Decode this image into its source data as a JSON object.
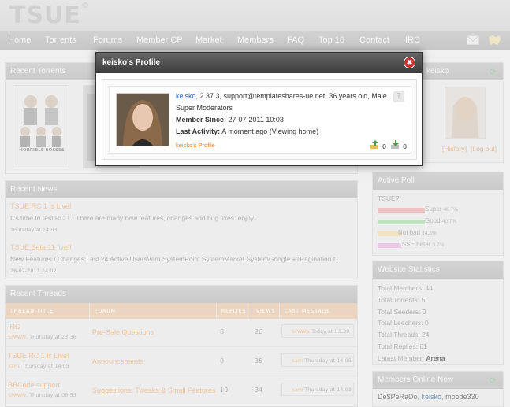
{
  "site": {
    "logo": "TSUE",
    "logo_mark": "©"
  },
  "nav": [
    "Home",
    "Torrents",
    "Forums",
    "Member CP",
    "Market",
    "Members",
    "FAQ",
    "Top 10",
    "Contact",
    "IRC"
  ],
  "recent_torrents": {
    "title": "Recent Torrents",
    "poster_caption": "HORRIBLE BOSSES"
  },
  "user_panel": {
    "title": "keisko",
    "links": [
      "[History]",
      "[Log out]"
    ]
  },
  "recent_news": {
    "title": "Recent News",
    "items": [
      {
        "title": "TSUE RC 1 is Live!",
        "text": "It's time to test RC 1.. There are many new features, changes and bug fixes. enjoy...",
        "date": "Thursday at 14:03"
      },
      {
        "title": "TSUE Beta 11 live!!",
        "text": "New Features / Changes:Last 24 Active Users\\/am SystemPoint SystemMarket SystemGoogle +1Pagination t...",
        "date": "26-07-2011 14:02"
      }
    ]
  },
  "recent_threads": {
    "title": "Recent Threads",
    "columns": [
      "THREAD TITLE",
      "FORUM",
      "REPLIES",
      "VIEWS",
      "LAST MESSAGE"
    ],
    "rows": [
      {
        "title": "IRC",
        "user": "SPAWN",
        "date": ", Thursday at 23:36",
        "forum": "Pre-Sale Questions",
        "replies": "8",
        "views": "26",
        "last_user": "SPAWN",
        "last_date": " Today at 03:39"
      },
      {
        "title": "TSUE RC 1 is Live!",
        "user": "xam",
        "date": ", Thursday at 14:05",
        "forum": "Announcements",
        "replies": "0",
        "views": "35",
        "last_user": "xam",
        "last_date": " Thursday at 14:05"
      },
      {
        "title": "BBCode support",
        "user": "SPAWN",
        "date": ", Thursday at 06:55",
        "forum": "Suggestions: Tweaks & Small Features",
        "replies": "10",
        "views": "34",
        "last_user": "xam",
        "last_date": " Thursday at 14:03"
      }
    ]
  },
  "poll": {
    "title": "Active Poll",
    "question": "TSUE?",
    "options": [
      {
        "label": "Super",
        "pct": "40.7%",
        "value": 40.7,
        "color": "#e8a0a0"
      },
      {
        "label": "Good",
        "pct": "40.7%",
        "value": 40.7,
        "color": "#9fd19f"
      },
      {
        "label": "Not bad",
        "pct": "14.8%",
        "value": 14.8,
        "color": "#ecd39a"
      },
      {
        "label": "TSSE beter",
        "pct": "3.7%",
        "value": 3.7,
        "color": "#e0a8d8"
      }
    ]
  },
  "stats": {
    "title": "Website Statistics",
    "rows": [
      {
        "label": "Total Members: ",
        "value": "44"
      },
      {
        "label": "Total Torrents: ",
        "value": "5"
      },
      {
        "label": "Total Seeders: ",
        "value": "0"
      },
      {
        "label": "Total Leechers: ",
        "value": "0"
      },
      {
        "label": "Total Threads: ",
        "value": "24"
      },
      {
        "label": "Total Replies: ",
        "value": "61"
      },
      {
        "label": "Latest Member: ",
        "value": "Arena"
      }
    ]
  },
  "online": {
    "title": "Members Online Now",
    "users": [
      "De$PeRaDo",
      "keisko",
      "moode330"
    ]
  },
  "modal": {
    "title": "keisko's Profile",
    "close": "✖",
    "name": "keisko",
    "line1_rest": ", 2             37.3, support@templateshares-ue.net, 36 years old, Male",
    "group": "Super Moderators",
    "member_since_label": "Member Since:",
    "member_since": " 27-07-2011 10:03",
    "last_activity_label": "Last Activity:",
    "last_activity": " A moment ago (Viewing home)",
    "profile_link": "keisko's Profile",
    "uploads": "0",
    "downloads": "0"
  }
}
